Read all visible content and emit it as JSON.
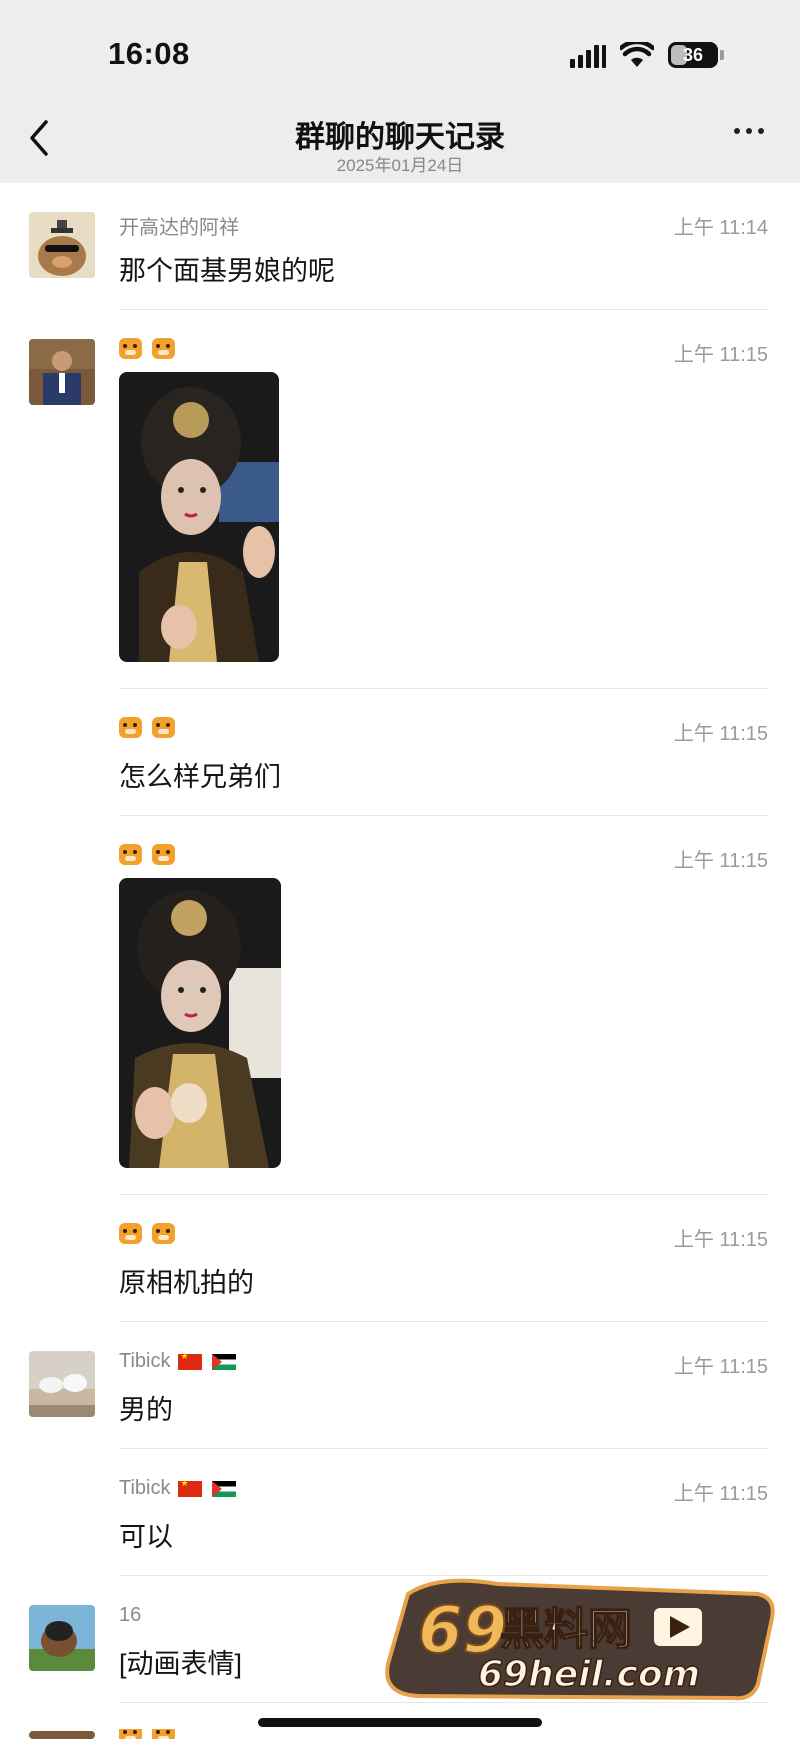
{
  "status_bar": {
    "time": "16:08",
    "battery": "36"
  },
  "nav": {
    "title": "群聊的聊天记录",
    "subtitle": "2025年01月24日",
    "back_icon": "chevron-left-icon",
    "more_icon": "more-dots-icon"
  },
  "messages": [
    {
      "sender": "开高达的阿祥",
      "time": "上午 11:14",
      "text": "那个面基男娘的呢"
    },
    {
      "sender": "🐯🐯",
      "time": "上午 11:15",
      "type": "image"
    },
    {
      "sender": "🐯🐯",
      "time": "上午 11:15",
      "text": "怎么样兄弟们"
    },
    {
      "sender": "🐯🐯",
      "time": "上午 11:15",
      "type": "image"
    },
    {
      "sender": "🐯🐯",
      "time": "上午 11:15",
      "text": "原相机拍的"
    },
    {
      "sender": "Tibick",
      "time": "上午 11:15",
      "text": "男的"
    },
    {
      "sender": "Tibick",
      "time": "上午 11:15",
      "text": "可以"
    },
    {
      "sender": "16",
      "time": "",
      "text": "[动画表情]"
    }
  ],
  "watermark": {
    "line1": "69黑料网",
    "line2": "69heil.com"
  },
  "colors": {
    "nav_bg": "#ededed",
    "divider": "#e6e6e6",
    "time_gray": "#9a9a9a",
    "watermark_gold": "#e8a24a"
  }
}
